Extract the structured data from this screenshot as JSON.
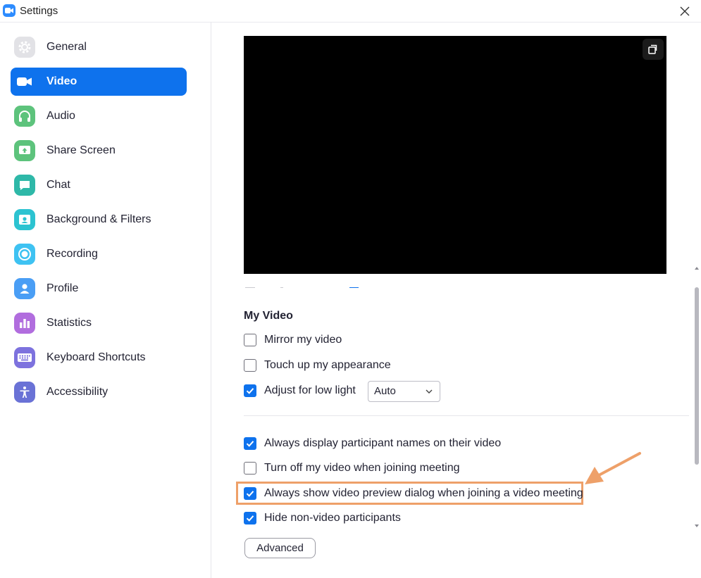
{
  "window": {
    "title": "Settings",
    "app_icon": "zoom-camera-icon"
  },
  "colors": {
    "accent": "#0e72ed",
    "highlight_border": "#eea069",
    "arrow": "#eea069",
    "preview_bg": "#000000"
  },
  "sidebar": {
    "items": [
      {
        "label": "General",
        "icon": "gear-icon",
        "icon_color": "#c8c8cf",
        "active": false
      },
      {
        "label": "Video",
        "icon": "video-camera-icon",
        "icon_color": "#ffffff",
        "active": true
      },
      {
        "label": "Audio",
        "icon": "headphones-icon",
        "icon_color": "#5dc37c",
        "active": false
      },
      {
        "label": "Share Screen",
        "icon": "share-screen-icon",
        "icon_color": "#5dc37c",
        "active": false
      },
      {
        "label": "Chat",
        "icon": "chat-bubble-icon",
        "icon_color": "#2eb8a8",
        "active": false
      },
      {
        "label": "Background & Filters",
        "icon": "background-person-icon",
        "icon_color": "#2cc3d1",
        "active": false
      },
      {
        "label": "Recording",
        "icon": "record-icon",
        "icon_color": "#3ec2f2",
        "active": false
      },
      {
        "label": "Profile",
        "icon": "person-icon",
        "icon_color": "#4a9ef5",
        "active": false
      },
      {
        "label": "Statistics",
        "icon": "bar-chart-icon",
        "icon_color": "#b16dde",
        "active": false
      },
      {
        "label": "Keyboard Shortcuts",
        "icon": "keyboard-icon",
        "icon_color": "#7d72de",
        "active": false
      },
      {
        "label": "Accessibility",
        "icon": "accessibility-icon",
        "icon_color": "#6a72d6",
        "active": false
      }
    ]
  },
  "main": {
    "preview": {
      "rotate_icon": "rotate-icon"
    },
    "my_video": {
      "title": "My Video",
      "options": [
        {
          "label": "Mirror my video",
          "checked": false
        },
        {
          "label": "Touch up my appearance",
          "checked": false
        },
        {
          "label": "Adjust for low light",
          "checked": true
        }
      ],
      "low_light_select": {
        "value": "Auto"
      }
    },
    "general_options": [
      {
        "label": "Always display participant names on their video",
        "checked": true
      },
      {
        "label": "Turn off my video when joining meeting",
        "checked": false
      },
      {
        "label": "Always show video preview dialog when joining a video meeting",
        "checked": true,
        "highlighted": true
      },
      {
        "label": "Hide non-video participants",
        "checked": true
      }
    ],
    "advanced_label": "Advanced"
  }
}
